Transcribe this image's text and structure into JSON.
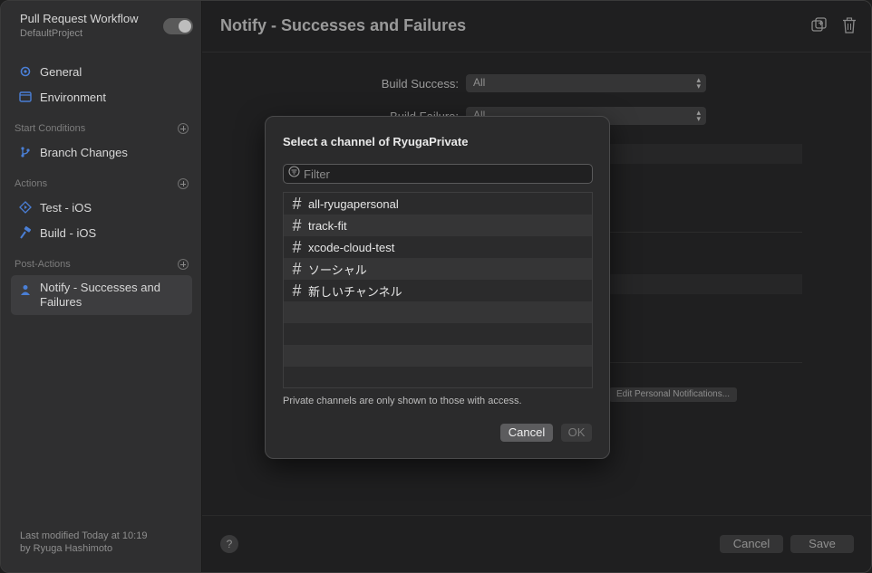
{
  "sidebar": {
    "workflow_title": "Pull Request Workflow",
    "workflow_subtitle": "DefaultProject",
    "general": "General",
    "environment": "Environment",
    "start_conditions": "Start Conditions",
    "branch_changes": "Branch Changes",
    "actions": "Actions",
    "test_ios": "Test - iOS",
    "build_ios": "Build - iOS",
    "post_actions": "Post-Actions",
    "notify_line1": "Notify - Successes and",
    "notify_line2": "Failures",
    "last_modified_line1": "Last modified Today at 10:19",
    "last_modified_line2": "by Ryuga Hashimoto"
  },
  "main": {
    "title": "Notify - Successes and Failures",
    "build_success_label": "Build Success:",
    "build_success_value": "All",
    "build_failure_label": "Build Failure:",
    "build_failure_value": "All",
    "edit_personal_notifications": "Edit Personal Notifications...",
    "help": "?",
    "cancel": "Cancel",
    "save": "Save"
  },
  "dialog": {
    "title": "Select a channel of RyugaPrivate",
    "filter_placeholder": "Filter",
    "channels": [
      "all-ryugapersonal",
      "track-fit",
      "xcode-cloud-test",
      "ソーシャル",
      "新しいチャンネル"
    ],
    "note": "Private channels are only shown to those with access.",
    "cancel": "Cancel",
    "ok": "OK"
  },
  "colors": {
    "sidebar_bg": "#2f2f30",
    "main_bg": "#1f1f20",
    "dialog_bg": "#2b2b2c",
    "accent_icon": "#4a7fd6"
  }
}
